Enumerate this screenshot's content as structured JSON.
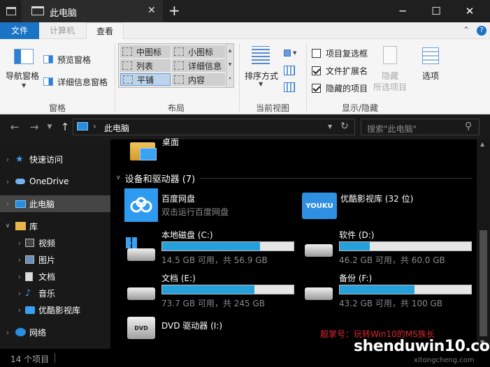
{
  "window": {
    "tab_title": "此电脑",
    "new_tab": "+",
    "minimize": "─",
    "maximize": "☐",
    "close": "✕"
  },
  "menu": {
    "file": "文件",
    "computer": "计算机",
    "view": "查看",
    "help": "?"
  },
  "ribbon": {
    "panes": {
      "nav_pane": "导航窗格",
      "preview_pane": "预览窗格",
      "details_pane": "详细信息窗格",
      "group_label": "窗格"
    },
    "layout": {
      "items": [
        "中图标",
        "小图标",
        "列表",
        "详细信息",
        "平铺",
        "内容"
      ],
      "group_label": "布局"
    },
    "current_view": {
      "sort_by": "排序方式",
      "group_label": "当前视图"
    },
    "show_hide": {
      "item_checkboxes": "项目复选框",
      "file_extensions": "文件扩展名",
      "hidden_items": "隐藏的项目",
      "hide_selected": "隐藏",
      "selected_items": "所选项目",
      "options": "选项",
      "group_label": "显示/隐藏"
    }
  },
  "address": {
    "breadcrumb": "此电脑",
    "separator": "›",
    "search_placeholder": "搜索\"此电脑\""
  },
  "sidebar": {
    "items": [
      {
        "label": "快速访问"
      },
      {
        "label": "OneDrive"
      },
      {
        "label": "此电脑"
      },
      {
        "label": "库"
      },
      {
        "label": "视频"
      },
      {
        "label": "图片"
      },
      {
        "label": "文档"
      },
      {
        "label": "音乐"
      },
      {
        "label": "优酷影视库"
      },
      {
        "label": "网络"
      }
    ]
  },
  "content": {
    "desktop_label": "桌面",
    "section_title": "设备和驱动器 (7)",
    "baidu": {
      "name": "百度网盘",
      "sub": "双击运行百度网盘"
    },
    "youku": {
      "name": "优酷影视库 (32 位)",
      "logo": "YOUKU"
    },
    "drives": [
      {
        "name": "本地磁盘 (C:)",
        "info": "14.5 GB 可用，共 56.9 GB",
        "used_fraction": 0.745
      },
      {
        "name": "软件 (D:)",
        "info": "46.2 GB 可用，共 60.0 GB",
        "used_fraction": 0.23
      },
      {
        "name": "文档 (E:)",
        "info": "73.7 GB 可用，共 245 GB",
        "used_fraction": 0.7
      },
      {
        "name": "备份 (F:)",
        "info": "43.2 GB 可用，共 100 GB",
        "used_fraction": 0.568
      }
    ],
    "dvd": {
      "name": "DVD 驱动器 (I:)",
      "disc_label": "DVD"
    }
  },
  "status": {
    "count": "14 个项目"
  },
  "watermark": {
    "wechat": "靓掌号：玩转Win10的MS族长",
    "site": "shenduwin10.com",
    "site_sub": "xitongcheng.com"
  },
  "colors": {
    "bar_fill": "#26a0da",
    "watermark_red": "#d9262b"
  }
}
